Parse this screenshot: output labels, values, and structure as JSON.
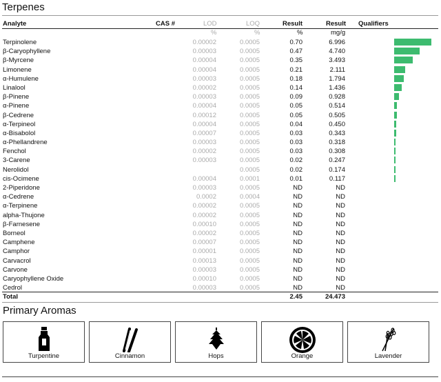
{
  "section_title": "Terpenes",
  "headers": {
    "analyte": "Analyte",
    "cas": "CAS #",
    "lod": "LOD",
    "loq": "LOQ",
    "result_pct": "Result",
    "result_mg": "Result",
    "qualifiers": "Qualifiers"
  },
  "units": {
    "lod": "%",
    "loq": "%",
    "pct": "%",
    "mg": "mg/g"
  },
  "rows": [
    {
      "name": "Terpinolene",
      "lod": "0.00002",
      "loq": "0.0005",
      "pct": "0.70",
      "mg": "6.996",
      "bar": 1.0
    },
    {
      "name": "β-Caryophyllene",
      "lod": "0.00003",
      "loq": "0.0005",
      "pct": "0.47",
      "mg": "4.740",
      "bar": 0.677
    },
    {
      "name": "β-Myrcene",
      "lod": "0.00004",
      "loq": "0.0005",
      "pct": "0.35",
      "mg": "3.493",
      "bar": 0.5
    },
    {
      "name": "Limonene",
      "lod": "0.00004",
      "loq": "0.0005",
      "pct": "0.21",
      "mg": "2.111",
      "bar": 0.3
    },
    {
      "name": "α-Humulene",
      "lod": "0.00003",
      "loq": "0.0005",
      "pct": "0.18",
      "mg": "1.794",
      "bar": 0.257
    },
    {
      "name": "Linalool",
      "lod": "0.00002",
      "loq": "0.0005",
      "pct": "0.14",
      "mg": "1.436",
      "bar": 0.2
    },
    {
      "name": "β-Pinene",
      "lod": "0.00003",
      "loq": "0.0005",
      "pct": "0.09",
      "mg": "0.928",
      "bar": 0.13
    },
    {
      "name": "α-Pinene",
      "lod": "0.00004",
      "loq": "0.0005",
      "pct": "0.05",
      "mg": "0.514",
      "bar": 0.073
    },
    {
      "name": "β-Cedrene",
      "lod": "0.00012",
      "loq": "0.0005",
      "pct": "0.05",
      "mg": "0.505",
      "bar": 0.072
    },
    {
      "name": "α-Terpineol",
      "lod": "0.00004",
      "loq": "0.0005",
      "pct": "0.04",
      "mg": "0.450",
      "bar": 0.064
    },
    {
      "name": "α-Bisabolol",
      "lod": "0.00007",
      "loq": "0.0005",
      "pct": "0.03",
      "mg": "0.343",
      "bar": 0.049
    },
    {
      "name": "α-Phellandrene",
      "lod": "0.00003",
      "loq": "0.0005",
      "pct": "0.03",
      "mg": "0.318",
      "bar": 0.045
    },
    {
      "name": "Fenchol",
      "lod": "0.00002",
      "loq": "0.0005",
      "pct": "0.03",
      "mg": "0.308",
      "bar": 0.044
    },
    {
      "name": "3-Carene",
      "lod": "0.00003",
      "loq": "0.0005",
      "pct": "0.02",
      "mg": "0.247",
      "bar": 0.035
    },
    {
      "name": "Nerolidol",
      "lod": "",
      "loq": "0.0005",
      "pct": "0.02",
      "mg": "0.174",
      "bar": 0.025
    },
    {
      "name": "cis-Ocimene",
      "lod": "0.00004",
      "loq": "0.0001",
      "pct": "0.01",
      "mg": "0.117",
      "bar": 0.017
    },
    {
      "name": "2-Piperidone",
      "lod": "0.00003",
      "loq": "0.0005",
      "pct": "ND",
      "mg": "ND",
      "bar": 0
    },
    {
      "name": "α-Cedrene",
      "lod": "0.0002",
      "loq": "0.0004",
      "pct": "ND",
      "mg": "ND",
      "bar": 0
    },
    {
      "name": "α-Terpinene",
      "lod": "0.00002",
      "loq": "0.0005",
      "pct": "ND",
      "mg": "ND",
      "bar": 0
    },
    {
      "name": "alpha-Thujone",
      "lod": "0.00002",
      "loq": "0.0005",
      "pct": "ND",
      "mg": "ND",
      "bar": 0
    },
    {
      "name": "β-Farnesene",
      "lod": "0.00010",
      "loq": "0.0005",
      "pct": "ND",
      "mg": "ND",
      "bar": 0
    },
    {
      "name": "Borneol",
      "lod": "0.00002",
      "loq": "0.0005",
      "pct": "ND",
      "mg": "ND",
      "bar": 0
    },
    {
      "name": "Camphene",
      "lod": "0.00007",
      "loq": "0.0005",
      "pct": "ND",
      "mg": "ND",
      "bar": 0
    },
    {
      "name": "Camphor",
      "lod": "0.00001",
      "loq": "0.0005",
      "pct": "ND",
      "mg": "ND",
      "bar": 0
    },
    {
      "name": "Carvacrol",
      "lod": "0.00013",
      "loq": "0.0005",
      "pct": "ND",
      "mg": "ND",
      "bar": 0
    },
    {
      "name": "Carvone",
      "lod": "0.00003",
      "loq": "0.0005",
      "pct": "ND",
      "mg": "ND",
      "bar": 0
    },
    {
      "name": "Caryophyllene Oxide",
      "lod": "0.00010",
      "loq": "0.0005",
      "pct": "ND",
      "mg": "ND",
      "bar": 0
    },
    {
      "name": "Cedrol",
      "lod": "0.00003",
      "loq": "0.0005",
      "pct": "ND",
      "mg": "ND",
      "bar": 0
    }
  ],
  "total": {
    "label": "Total",
    "pct": "2.45",
    "mg": "24.473"
  },
  "aromas_title": "Primary Aromas",
  "aromas": [
    {
      "label": "Turpentine",
      "icon": "bottle-icon"
    },
    {
      "label": "Cinnamon",
      "icon": "cinnamon-sticks-icon"
    },
    {
      "label": "Hops",
      "icon": "hops-icon"
    },
    {
      "label": "Orange",
      "icon": "orange-slice-icon"
    },
    {
      "label": "Lavender",
      "icon": "lavender-icon"
    }
  ],
  "colors": {
    "bar": "#3dbb6f"
  }
}
